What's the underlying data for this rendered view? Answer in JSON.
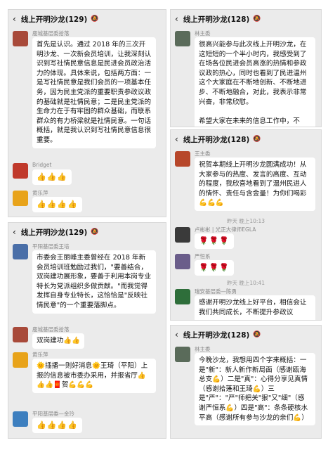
{
  "chats": [
    {
      "title": "线上开明沙龙(129)",
      "messages": [
        {
          "sender": "鹿城基层委拾落",
          "text": "首先是认识。通过 2018 年的三次开明沙龙、一次新会员培训，让我深刻认识到写社情民意信息是民进会员政治活力的体现。具体来说，包括两方面：一是写社情民意是我们会员的一项基本任务，因为民主党派的重要职责参政议政的基础就是社情民意；二是民主党派的生命力在于有牢固的群众基础，而联系群众的有力桥梁就是社情民意。一句话概括，就是我认识到写社情民意信息很重要。"
        },
        {
          "sender": "Bridget",
          "text": "👍👍👍"
        },
        {
          "sender": "黄乐萍",
          "text": "👍👍👍👍"
        }
      ]
    },
    {
      "title": "线上开明沙龙(128)",
      "messages": [
        {
          "sender": "林主委",
          "text": "很高兴能参与此次线上开明沙龙，在这短短的一个半小时内，我感受到了在场各位民进会员高涨的热情和参政议政的热心，同时也看到了民进温州这个大家庭在不断地创新、不断地进步、不断地融合，对此，我表示非常兴奋，非常欣慰。\n\n希望大家在未来的信息工作中，不"
        }
      ]
    },
    {
      "title": "线上开明沙龙(128)",
      "messages": [
        {
          "sender": "王主委",
          "text": "祝贺本期线上开明沙龙圆满成功！从大家参与的热度、发言的高度、互动的程度，我欣喜地看到了温州民进人的情怀、责任与含金量！为你们喝彩💪💪💪"
        },
        {
          "sender": "卢彬彬 | 光正大律师EGLA",
          "text": "🌹🌹🌹"
        },
        {
          "sender": "严恒系",
          "text": "🌹🌹🌹"
        },
        {
          "sender": "瑞安基层委—陈勇",
          "text": "感谢开明沙龙线上好平台，相信会让我们共同成长，不断提升参政议"
        }
      ],
      "timestamps": [
        "昨天 晚上10:13",
        "昨天 晚上10:41"
      ]
    },
    {
      "title": "线上开明沙龙(129)",
      "messages": [
        {
          "sender": "平阳基层委王培",
          "text": "市委会王丽峰主委曾经在 2018 年新会员培训班勉励过我们，\"要善结合，双岗建功展形象，要善于利用本岗专业特长为党派组织多做贡献。\"而我觉得发挥自身专业特长，这恰恰是\"反映社情民意\"的一个重要落脚点。"
        },
        {
          "sender": "鹿城基层委拾落",
          "text": "双岗建功👍👍"
        },
        {
          "sender": "黄乐萍",
          "text": "🌞插播一则好消息🌞王琦（平阳）上报的信息被市委办采用，并报省厅👍👍👍🧧贺💪💪💪"
        },
        {
          "sender": "平阳基层委—金玲",
          "text": "👍👍👍👍"
        }
      ]
    },
    {
      "title": "线上开明沙龙(128)",
      "messages": [
        {
          "sender": "林主委",
          "text": "今晚沙龙，我想用四个字来概括：一是\"新\"：新人新作新局面（感谢瓯海总支💪）二是\"真\"：心得分享见真情（感谢拾蓬和王琦💪）三是\"严\"：\"严\"师把关\"狠\"又\"细\"（感谢严恒系💪）四是\"高\"：条条硬核水平高（感谢所有参与沙龙的亲们💪）"
        }
      ]
    }
  ],
  "ui": {
    "back_icon": "‹",
    "mute_icon": "🔕",
    "colors": {
      "panel_bg": "#ebebeb",
      "bubble_bg": "#ffffff",
      "meta_text": "#8a8a8a"
    }
  }
}
